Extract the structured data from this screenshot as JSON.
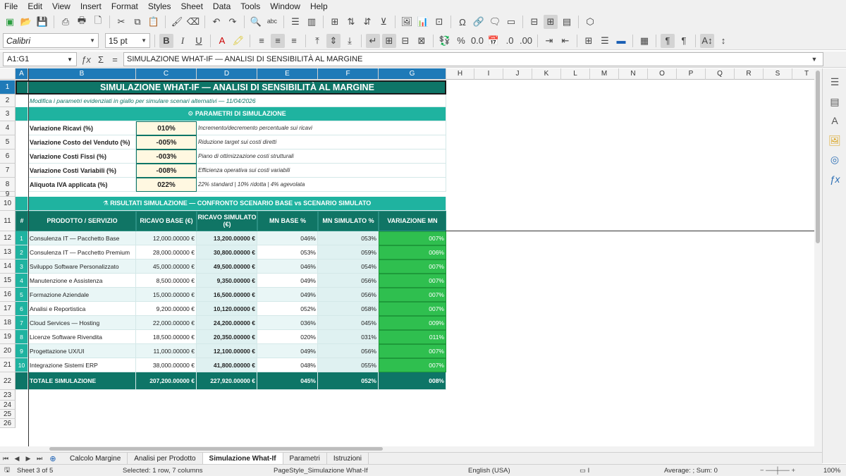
{
  "menu": [
    "File",
    "Edit",
    "View",
    "Insert",
    "Format",
    "Styles",
    "Sheet",
    "Data",
    "Tools",
    "Window",
    "Help"
  ],
  "toolbar": {
    "font_name": "Calibri",
    "font_size": "15 pt"
  },
  "formula_bar": {
    "name_box": "A1:G1",
    "content": "SIMULAZIONE WHAT-IF — ANALISI DI SENSIBILITÀ AL MARGINE"
  },
  "columns": [
    "A",
    "B",
    "C",
    "D",
    "E",
    "F",
    "G",
    "H",
    "I",
    "J",
    "K",
    "L",
    "M",
    "N",
    "O",
    "P",
    "Q",
    "R",
    "S",
    "T"
  ],
  "row_numbers": [
    "1",
    "2",
    "3",
    "4",
    "5",
    "6",
    "7",
    "8",
    "9",
    "10",
    "11",
    "12",
    "13",
    "14",
    "15",
    "16",
    "17",
    "18",
    "19",
    "20",
    "21",
    "22",
    "23",
    "24",
    "25",
    "26"
  ],
  "title": "SIMULAZIONE WHAT-IF — ANALISI DI SENSIBILITÀ AL MARGINE",
  "subtitle": "Modifica i parametri evidenziati in giallo per simulare scenari alternativi — 11/04/2026",
  "params_header": "⚙ PARAMETRI DI SIMULAZIONE",
  "params": [
    {
      "label": "Variazione Ricavi (%)",
      "value": "010%",
      "note": "Incremento/decremento percentuale sui ricavi"
    },
    {
      "label": "Variazione Costo del Venduto (%)",
      "value": "-005%",
      "note": "Riduzione target sui costi diretti"
    },
    {
      "label": "Variazione Costi Fissi (%)",
      "value": "-003%",
      "note": "Piano di ottimizzazione costi strutturali"
    },
    {
      "label": "Variazione Costi Variabili (%)",
      "value": "-008%",
      "note": "Efficienza operativa sui costi variabili"
    },
    {
      "label": "Aliquota IVA applicata (%)",
      "value": "022%",
      "note": "22% standard | 10% ridotta | 4% agevolata"
    }
  ],
  "results_header": "⚗ RISULTATI SIMULAZIONE — CONFRONTO SCENARIO BASE vs SCENARIO SIMULATO",
  "table_headers": [
    "#",
    "PRODOTTO / SERVIZIO",
    "RICAVO BASE (€)",
    "RICAVO SIMULATO (€)",
    "MN BASE %",
    "MN SIMULATO %",
    "VARIAZIONE MN"
  ],
  "rows": [
    [
      "1",
      "Consulenza IT — Pacchetto Base",
      "12,000.00000 €",
      "13,200.00000 €",
      "046%",
      "053%",
      "007%"
    ],
    [
      "2",
      "Consulenza IT — Pacchetto Premium",
      "28,000.00000 €",
      "30,800.00000 €",
      "053%",
      "059%",
      "006%"
    ],
    [
      "3",
      "Sviluppo Software Personalizzato",
      "45,000.00000 €",
      "49,500.00000 €",
      "046%",
      "054%",
      "007%"
    ],
    [
      "4",
      "Manutenzione e Assistenza",
      "8,500.00000 €",
      "9,350.00000 €",
      "049%",
      "056%",
      "007%"
    ],
    [
      "5",
      "Formazione Aziendale",
      "15,000.00000 €",
      "16,500.00000 €",
      "049%",
      "056%",
      "007%"
    ],
    [
      "6",
      "Analisi e Reportistica",
      "9,200.00000 €",
      "10,120.00000 €",
      "052%",
      "058%",
      "007%"
    ],
    [
      "7",
      "Cloud Services — Hosting",
      "22,000.00000 €",
      "24,200.00000 €",
      "036%",
      "045%",
      "009%"
    ],
    [
      "8",
      "Licenze Software Rivendita",
      "18,500.00000 €",
      "20,350.00000 €",
      "020%",
      "031%",
      "011%"
    ],
    [
      "9",
      "Progettazione UX/UI",
      "11,000.00000 €",
      "12,100.00000 €",
      "049%",
      "056%",
      "007%"
    ],
    [
      "10",
      "Integrazione Sistemi ERP",
      "38,000.00000 €",
      "41,800.00000 €",
      "048%",
      "055%",
      "007%"
    ]
  ],
  "total": [
    "TOTALE SIMULAZIONE",
    "207,200.00000 €",
    "227,920.00000 €",
    "045%",
    "052%",
    "008%"
  ],
  "sheet_tabs": [
    "Calcolo Margine",
    "Analisi per Prodotto",
    "Simulazione What-If",
    "Parametri",
    "Istruzioni"
  ],
  "active_tab": "Simulazione What-If",
  "status": {
    "sheet": "Sheet 3 of 5",
    "selection": "Selected: 1 row, 7 columns",
    "page_style": "PageStyle_Simulazione What-If",
    "language": "English (USA)",
    "sum": "Average: ; Sum: 0",
    "zoom": "100%"
  },
  "colors": {
    "teal_dark": "#0e7567",
    "teal_mid": "#1fb3a0",
    "header_teal": "#107565",
    "green_var": "#2fbf4f",
    "input_yellow": "#fff8e1"
  }
}
